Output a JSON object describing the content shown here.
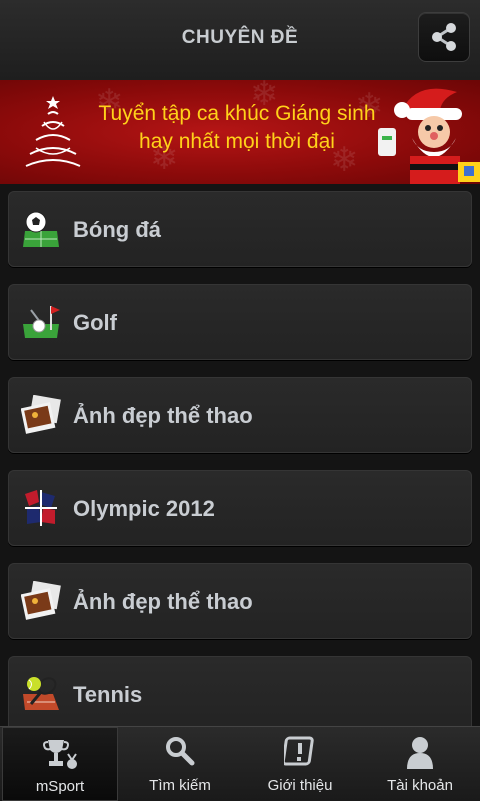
{
  "header": {
    "title": "CHUYÊN ĐỀ"
  },
  "banner": {
    "line1": "Tuyển tập ca khúc Giáng sinh",
    "line2": "hay nhất mọi thời đại",
    "text_color": "#ffd21a",
    "background_color": "#a50f0f"
  },
  "list": {
    "items": [
      {
        "label": "Bóng đá",
        "icon": "soccer-icon"
      },
      {
        "label": "Golf",
        "icon": "golf-icon"
      },
      {
        "label": "Ảnh đẹp thể thao",
        "icon": "photos-icon"
      },
      {
        "label": "Olympic 2012",
        "icon": "olympic-icon"
      },
      {
        "label": "Ảnh đẹp thể thao",
        "icon": "photos-icon"
      },
      {
        "label": "Tennis",
        "icon": "tennis-icon"
      }
    ]
  },
  "bottom_nav": {
    "items": [
      {
        "label": "mSport",
        "icon": "trophy-icon",
        "active": true
      },
      {
        "label": "Tìm kiếm",
        "icon": "search-icon",
        "active": false
      },
      {
        "label": "Giới thiệu",
        "icon": "info-icon",
        "active": false
      },
      {
        "label": "Tài khoản",
        "icon": "user-icon",
        "active": false
      }
    ]
  }
}
